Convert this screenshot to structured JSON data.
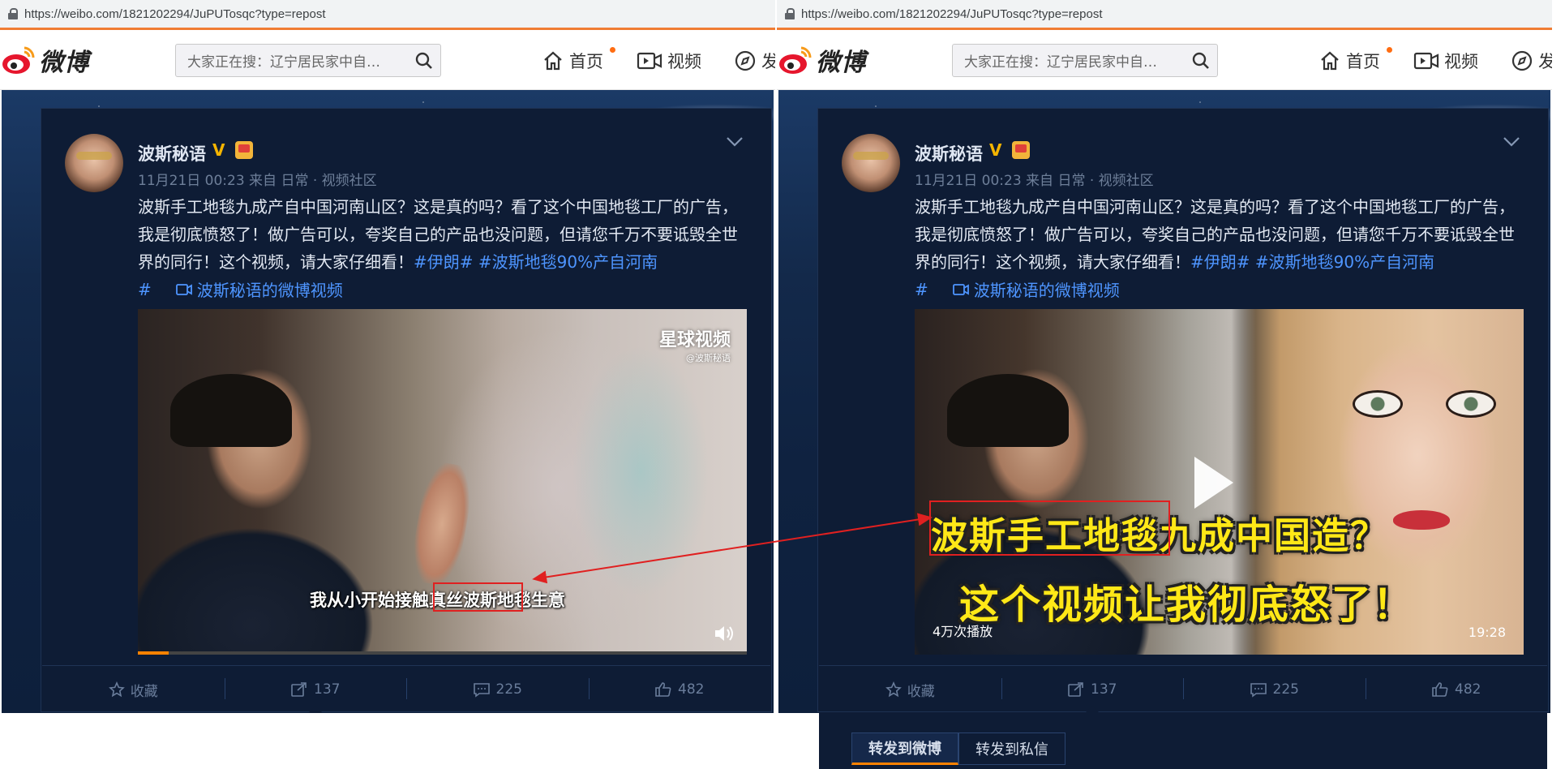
{
  "browser": {
    "url": "https://weibo.com/1821202294/JuPUTosqc?type=repost"
  },
  "header": {
    "logo_text": "微博",
    "search_placeholder": "大家正在搜：辽宁居民家中自…",
    "nav": [
      {
        "label": "首页",
        "icon": "home-icon",
        "has_dot": true
      },
      {
        "label": "视频",
        "icon": "video-icon",
        "has_dot": false
      },
      {
        "label": "发",
        "icon": "compass-icon",
        "has_dot": false
      }
    ]
  },
  "post": {
    "username": "波斯秘语",
    "verified_badge": "V",
    "meta": "11月21日 00:23 来自 日常 · 视频社区",
    "text_plain": "波斯手工地毯九成产自中国河南山区？这是真的吗？看了这个中国地毯工厂的广告，我是彻底愤怒了！做广告可以，夸奖自己的产品也没问题，但请您千万不要诋毁全世界的同行！这个视频，请大家仔细看！",
    "tag1": "#伊朗#",
    "tag2": "#波斯地毯90%产自河南",
    "tag2_end": "#",
    "video_link": "波斯秘语的微博视频"
  },
  "video_left": {
    "watermark": "星球视频",
    "watermark_sub": "@波斯秘语",
    "subtitle": "我从小开始接触真丝波斯地毯生意",
    "progress": 0.05
  },
  "video_right": {
    "title_line1": "波斯手工地毯九成中国造？",
    "title_line2": "这个视频让我彻底怒了！",
    "plays": "4万次播放",
    "duration": "19:28"
  },
  "actions": [
    {
      "label": "收藏",
      "icon": "star-icon"
    },
    {
      "label": "137",
      "icon": "share-icon"
    },
    {
      "label": "225",
      "icon": "comment-icon"
    },
    {
      "label": "482",
      "icon": "like-icon"
    }
  ],
  "repost_tabs": [
    {
      "label": "转发到微博",
      "active": true
    },
    {
      "label": "转发到私信",
      "active": false
    }
  ],
  "colors": {
    "accent_orange": "#ff8200",
    "link_blue": "#4e95ff",
    "annotation_red": "#e02020",
    "card_bg": "#0e1c35",
    "title_yellow": "#ffe817"
  }
}
